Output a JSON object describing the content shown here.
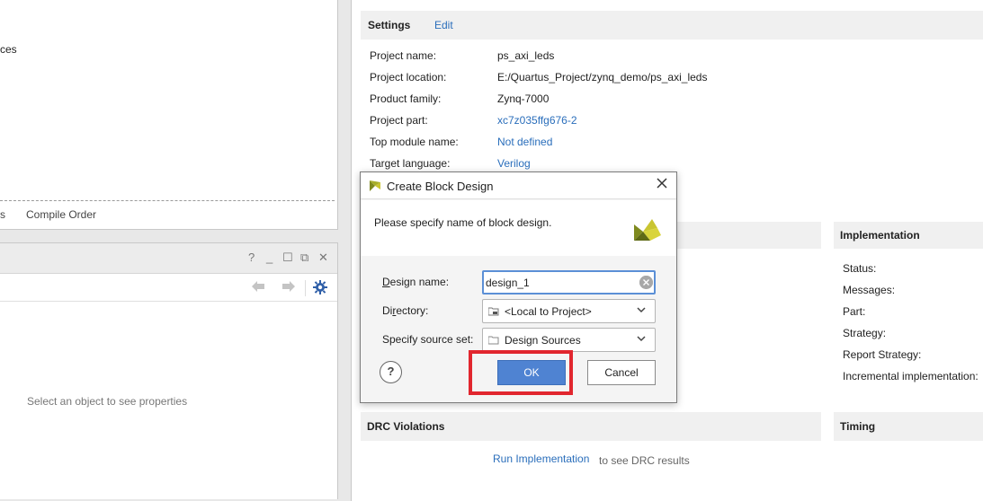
{
  "sources_panel": {
    "tree_fragment": "ces",
    "tab_fragment": "s",
    "tab_compile_order": "Compile Order"
  },
  "properties_panel": {
    "header_icons": [
      "help-icon",
      "minimize-icon",
      "maximize-icon",
      "float-icon",
      "close-icon"
    ],
    "header_glyphs": {
      "help": "?",
      "minimize": "_",
      "maximize": "☐",
      "float": "⧉",
      "close": "✕"
    },
    "empty_message": "Select an object to see properties"
  },
  "settings": {
    "title": "Settings",
    "edit": "Edit",
    "rows": [
      {
        "label": "Project name:",
        "value": "ps_axi_leds",
        "link": false
      },
      {
        "label": "Project location:",
        "value": "E:/Quartus_Project/zynq_demo/ps_axi_leds",
        "link": false
      },
      {
        "label": "Product family:",
        "value": "Zynq-7000",
        "link": false
      },
      {
        "label": "Project part:",
        "value": "xc7z035ffg676-2",
        "link": true
      },
      {
        "label": "Top module name:",
        "value": "Not defined",
        "link": true
      },
      {
        "label": "Target language:",
        "value": "Verilog",
        "link": true
      }
    ]
  },
  "implementation": {
    "title": "Implementation",
    "labels": [
      "Status:",
      "Messages:",
      "Part:",
      "Strategy:",
      "Report Strategy:",
      "Incremental implementation:"
    ]
  },
  "drc": {
    "title": "DRC Violations",
    "run_link": "Run Implementation",
    "suffix": "to see DRC results"
  },
  "timing": {
    "title": "Timing"
  },
  "dialog": {
    "title": "Create Block Design",
    "message": "Please specify name of block design.",
    "design_name_label_u": "D",
    "design_name_label_rest": "esign name:",
    "design_name_value": "design_1",
    "directory_label_pre": "Di",
    "directory_label_u": "r",
    "directory_label_post": "ectory:",
    "directory_value": "<Local to Project>",
    "source_set_label": "Specify source set:",
    "source_set_value": "Design Sources",
    "help": "?",
    "ok": "OK",
    "cancel": "Cancel"
  },
  "colors": {
    "accent": "#4f83d2",
    "link": "#2a6ebb",
    "highlight": "#e1262e",
    "logo_yellow": "#c9c531",
    "logo_green": "#7f8a1f"
  }
}
